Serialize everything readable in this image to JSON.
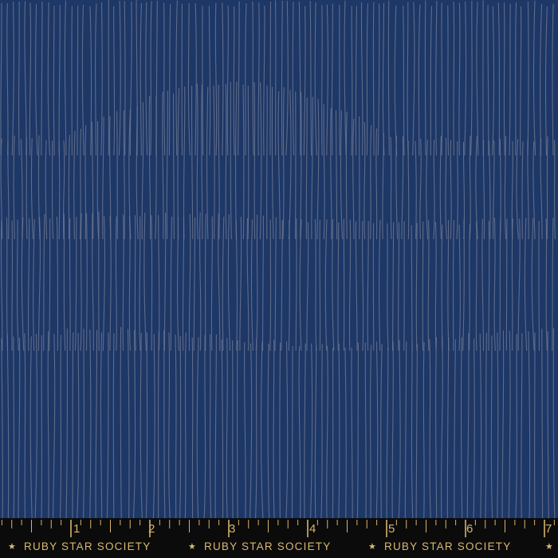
{
  "fabric": {
    "background_color": "#1d3766",
    "stripe_color": "#6c7690",
    "pattern": "vertical hand-drawn stripes in wavy bands"
  },
  "selvage": {
    "background_color": "#0b0b0b",
    "accent_color": "#d6b46a",
    "ruler_numbers": [
      "1",
      "2",
      "3",
      "4",
      "5",
      "6",
      "7"
    ],
    "brand_text": [
      "RUBY STAR SOCIETY",
      "RUBY STAR SOCIETY",
      "RUBY STAR SOCIETY"
    ],
    "star_icon": "star-icon"
  }
}
